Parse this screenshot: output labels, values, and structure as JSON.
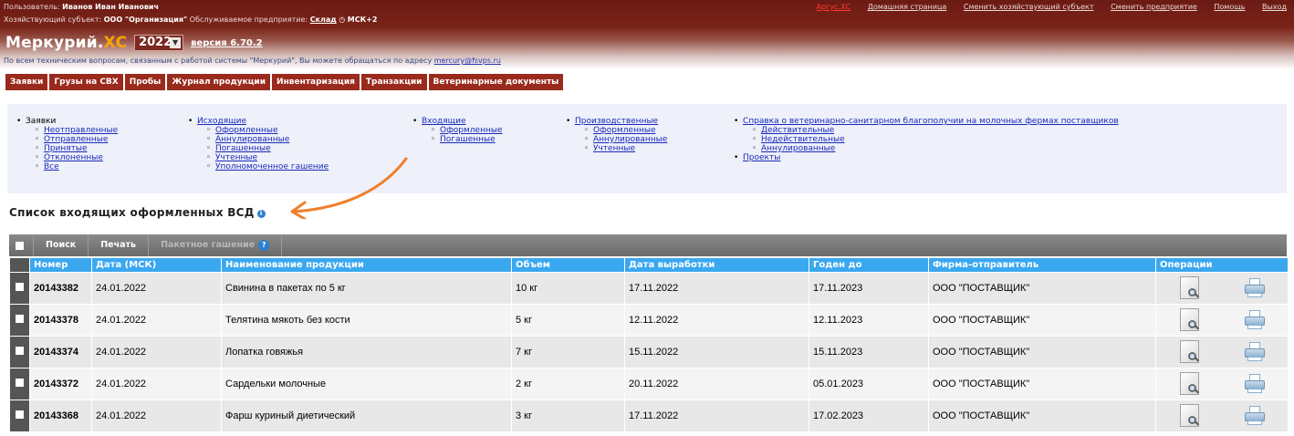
{
  "header": {
    "user_label": "Пользователь:",
    "user_name": "Иванов Иван Иванович",
    "subject_label": "Хозяйствующий субъект:",
    "subject_name": "ООО \"Организация\"",
    "enterprise_label": "Обслуживаемое предприятие:",
    "enterprise_name": "Склад",
    "timezone": "МСК+2",
    "links": [
      "Аргус.ХС",
      "Домашняя страница",
      "Сменить хозяйствующий субъект",
      "Сменить предприятие",
      "Помощь",
      "Выход"
    ],
    "brand_main": "Меркурий.",
    "brand_suffix": "ХС",
    "year": "2022",
    "version": "версия 6.70.2",
    "support_text": "По всем техническим вопросам, связанным с работой системы \"Меркурий\", Вы можете обращаться по адресу",
    "support_email": "mercury@fsvps.ru"
  },
  "main_menu": [
    "Заявки",
    "Грузы на СВХ",
    "Пробы",
    "Журнал продукции",
    "Инвентаризация",
    "Транзакции",
    "Ветеринарные документы"
  ],
  "submenu": {
    "col1": {
      "head": "Заявки",
      "items": [
        "Неотправленные",
        "Отправленные",
        "Принятые",
        "Отклоненные",
        "Все"
      ]
    },
    "col2": {
      "head": "Исходящие",
      "items": [
        "Оформленные",
        "Аннулированные",
        "Погашенные",
        "Учтенные",
        "Уполномоченное гашение"
      ]
    },
    "col3": {
      "head": "Входящие",
      "items": [
        "Оформленные",
        "Погашенные"
      ]
    },
    "col4": {
      "head": "Производственные",
      "items": [
        "Оформленные",
        "Аннулированные",
        "Учтенные"
      ]
    },
    "col5": {
      "head": "Справка о ветеринарно-санитарном благополучии на молочных фермах поставщиков",
      "items": [
        "Действительные",
        "Недействительные",
        "Аннулированные"
      ],
      "extra": "Проекты"
    }
  },
  "page_title": "Список входящих оформленных ВСД",
  "info_glyph": "i",
  "toolbar": {
    "search": "Поиск",
    "print": "Печать",
    "batch": "Пакетное гашение",
    "help": "?"
  },
  "table": {
    "columns": [
      "Номер",
      "Дата (МСК)",
      "Наименование продукции",
      "Объем",
      "Дата выработки",
      "Годен до",
      "Фирма-отправитель",
      "Операции"
    ],
    "rows": [
      {
        "num": "20143382",
        "date": "24.01.2022",
        "name": "Свинина в пакетах по 5 кг",
        "volume": "10 кг",
        "produced": "17.11.2022",
        "expires": "17.11.2023",
        "sender": "ООО \"ПОСТАВЩИК\""
      },
      {
        "num": "20143378",
        "date": "24.01.2022",
        "name": "Телятина мякоть без кости",
        "volume": "5 кг",
        "produced": "12.11.2022",
        "expires": "12.11.2023",
        "sender": "ООО \"ПОСТАВЩИК\""
      },
      {
        "num": "20143374",
        "date": "24.01.2022",
        "name": "Лопатка говяжья",
        "volume": "7 кг",
        "produced": "15.11.2022",
        "expires": "15.11.2023",
        "sender": "ООО \"ПОСТАВЩИК\""
      },
      {
        "num": "20143372",
        "date": "24.01.2022",
        "name": "Сардельки молочные",
        "volume": "2 кг",
        "produced": "20.11.2022",
        "expires": "05.01.2023",
        "sender": "ООО \"ПОСТАВЩИК\""
      },
      {
        "num": "20143368",
        "date": "24.01.2022",
        "name": "Фарш куриный диетический",
        "volume": "3 кг",
        "produced": "17.11.2022",
        "expires": "17.02.2023",
        "sender": "ООО \"ПОСТАВЩИК\""
      }
    ]
  },
  "colors": {
    "header_dark": "#6b1a14",
    "menu_red": "#9a2b1c",
    "brand_accent": "#f6a500",
    "table_header": "#3aa8ef",
    "annotation_arrow": "#f07f2a"
  },
  "icons": {
    "view": "view-document-icon",
    "print": "printer-icon"
  }
}
